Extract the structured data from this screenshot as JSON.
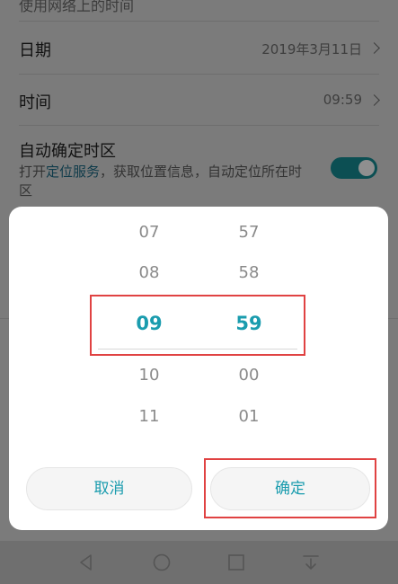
{
  "settings": {
    "top_text": "使用网络上的时间",
    "date_label": "日期",
    "date_value": "2019年3月11日",
    "time_label": "时间",
    "time_value": "09:59",
    "auto_tz_label": "自动确定时区",
    "auto_tz_desc_prefix": "打开",
    "auto_tz_desc_link": "定位服务",
    "auto_tz_desc_suffix": "，获取位置信息，自动定位所在时区",
    "auto_tz_enabled": true
  },
  "picker": {
    "hours": [
      "07",
      "08",
      "09",
      "10",
      "11"
    ],
    "minutes": [
      "57",
      "58",
      "59",
      "00",
      "01"
    ],
    "selected_hour": "09",
    "selected_minute": "59"
  },
  "buttons": {
    "cancel_label": "取消",
    "ok_label": "确定"
  },
  "colors": {
    "accent": "#1a9cae",
    "highlight": "#e04242"
  },
  "navbar": {
    "icons": [
      "back-icon",
      "home-icon",
      "recent-apps-icon",
      "notification-icon"
    ]
  }
}
